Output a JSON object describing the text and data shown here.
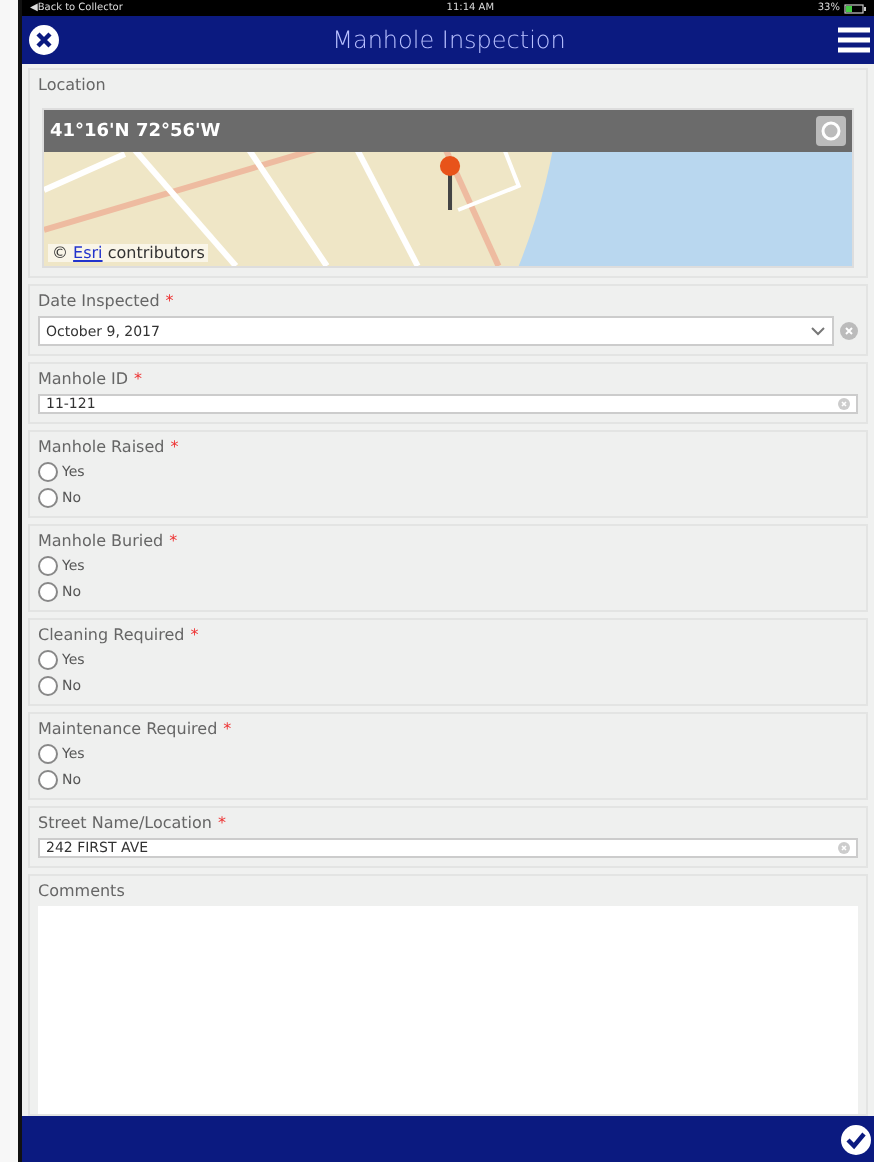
{
  "status_bar": {
    "back": "◀Back to Collector",
    "time": "11:14 AM",
    "battery": "33%"
  },
  "header": {
    "title": "Manhole Inspection"
  },
  "fields": [
    {
      "kind": "map",
      "label": "Location",
      "coordinates": "41°16'N 72°56'W",
      "attribution_prefix": "©",
      "attribution_link": "Esri",
      "attribution_suffix": "contributors"
    },
    {
      "kind": "date",
      "label": "Date Inspected",
      "required_mark": "*",
      "value": "October 9, 2017"
    },
    {
      "kind": "text",
      "label": "Manhole ID",
      "required_mark": "*",
      "value": "11-121"
    },
    {
      "kind": "radio",
      "label": "Manhole Raised",
      "required_mark": "*",
      "options": [
        {
          "label": "Yes",
          "selected": false
        },
        {
          "label": "No",
          "selected": false
        }
      ]
    },
    {
      "kind": "radio",
      "label": "Manhole Buried",
      "required_mark": "*",
      "options": [
        {
          "label": "Yes",
          "selected": false
        },
        {
          "label": "No",
          "selected": false
        }
      ]
    },
    {
      "kind": "radio",
      "label": "Cleaning Required",
      "required_mark": "*",
      "options": [
        {
          "label": "Yes",
          "selected": false
        },
        {
          "label": "No",
          "selected": false
        }
      ]
    },
    {
      "kind": "radio",
      "label": "Maintenance Required",
      "required_mark": "*",
      "options": [
        {
          "label": "Yes",
          "selected": false
        },
        {
          "label": "No",
          "selected": false
        }
      ]
    },
    {
      "kind": "text",
      "label": "Street Name/Location",
      "required_mark": "*",
      "value": "242 FIRST AVE"
    },
    {
      "kind": "textarea",
      "label": "Comments"
    }
  ]
}
